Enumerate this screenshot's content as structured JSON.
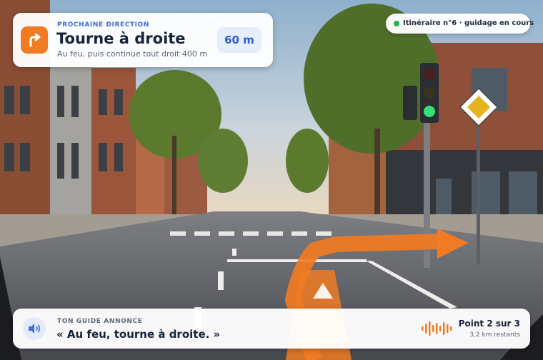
{
  "direction": {
    "kicker": "PROCHAINE DIRECTION",
    "title": "Tourne à droite",
    "subtitle": "Au feu, puis continue tout droit 400 m",
    "distance": "60 m",
    "icon": "turn-right-arrow-icon"
  },
  "status": {
    "text": "Itinéraire n°6 · guidage en cours",
    "dot_color": "#23b24b"
  },
  "voice": {
    "kicker": "TON GUIDE ANNONCE",
    "quote": "« Au feu, tourne à droite. »",
    "icon": "speaker-icon",
    "wave_icon": "audio-waveform-icon"
  },
  "progress": {
    "title": "Point 2 sur 3",
    "remaining": "3,2 km restants"
  },
  "colors": {
    "accent": "#f07b22",
    "blue": "#3d6fd6"
  }
}
